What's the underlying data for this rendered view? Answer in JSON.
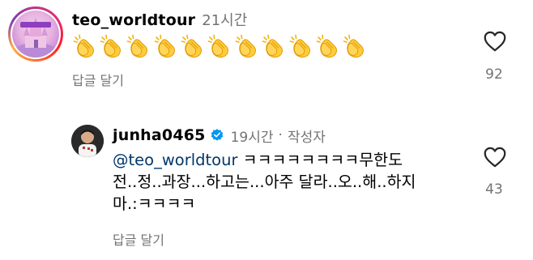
{
  "comments": [
    {
      "username": "teo_worldtour",
      "time": "21시간",
      "text": "👏👏👏👏👏👏👏👏👏👏👏",
      "reply_label": "답글 달기",
      "like_count": "92"
    },
    {
      "username": "junha0465",
      "verified": true,
      "time": "19시간",
      "author_badge": "작성자",
      "separator": "·",
      "mention": "@teo_worldtour",
      "text_line1": "ㅋㅋㅋㅋㅋㅋㅋㅋ무한도",
      "text_line2": "전..정..과장...하고는...아주 달라..오..해..하지",
      "text_line3": "마.:ㅋㅋㅋㅋ",
      "reply_label": "답글 달기",
      "like_count": "43"
    }
  ],
  "icons": {
    "heart": "heart-outline-icon",
    "verified": "verified-badge-icon",
    "clap": "clapping-hands-emoji"
  },
  "colors": {
    "secondary_text": "#737373",
    "mention": "#00376b",
    "verified": "#0095f6"
  }
}
